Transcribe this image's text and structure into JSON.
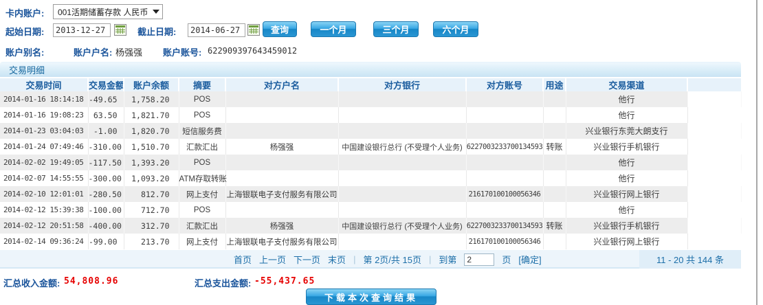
{
  "form": {
    "account_label": "卡内账户:",
    "account_select": "001活期储蓄存款 人民币",
    "start_label": "起始日期:",
    "start_value": "2013-12-27",
    "end_label": "截止日期:",
    "end_value": "2014-06-27",
    "query_button": "查询",
    "one_month_button": "一个月",
    "three_month_button": "三个月",
    "six_month_button": "六个月",
    "alias_label": "账户别名:",
    "alias_value": "",
    "holder_label": "账户户名:",
    "holder_value": "杨强强",
    "account_no_label": "账户账号:",
    "account_no_value": "622909397643459012"
  },
  "section_title": "交易明细",
  "table": {
    "headers": [
      "交易时间",
      "交易金额",
      "账户余额",
      "摘要",
      "对方户名",
      "对方银行",
      "对方账号",
      "用途",
      "交易渠道"
    ],
    "rows": [
      [
        "2014-01-16 18:14:18",
        "-49.65",
        "1,758.20",
        "POS",
        "",
        "",
        "",
        "",
        "他行"
      ],
      [
        "2014-01-16 19:08:23",
        "63.50",
        "1,821.70",
        "POS",
        "",
        "",
        "",
        "",
        "他行"
      ],
      [
        "2014-01-23 03:04:03",
        "-1.00",
        "1,820.70",
        "短信服务费",
        "",
        "",
        "",
        "",
        "兴业银行东莞大朗支行"
      ],
      [
        "2014-01-24 07:49:46",
        "-310.00",
        "1,510.70",
        "汇款汇出",
        "杨强强",
        "中国建设银行总行 (不受理个人业务)",
        "6227003233700134593",
        "转账",
        "兴业银行手机银行"
      ],
      [
        "2014-02-02 19:49:05",
        "-117.50",
        "1,393.20",
        "POS",
        "",
        "",
        "",
        "",
        "他行"
      ],
      [
        "2014-02-07 14:55:55",
        "-300.00",
        "1,093.20",
        "ATM存取转账",
        "",
        "",
        "",
        "",
        "他行"
      ],
      [
        "2014-02-10 12:01:01",
        "-280.50",
        "812.70",
        "网上支付",
        "上海银联电子支付服务有限公司",
        "",
        "216170100100056346",
        "",
        "兴业银行网上银行"
      ],
      [
        "2014-02-12 15:39:38",
        "-100.00",
        "712.70",
        "POS",
        "",
        "",
        "",
        "",
        "他行"
      ],
      [
        "2014-02-12 20:51:58",
        "-400.00",
        "312.70",
        "汇款汇出",
        "杨强强",
        "中国建设银行总行 (不受理个人业务)",
        "6227003233700134593",
        "转账",
        "兴业银行手机银行"
      ],
      [
        "2014-02-14 09:36:24",
        "-99.00",
        "213.70",
        "网上支付",
        "上海银联电子支付服务有限公司",
        "",
        "216170100100056346",
        "",
        "兴业银行网上银行"
      ]
    ]
  },
  "pagination": {
    "first": "首页",
    "prev": "上一页",
    "next": "下一页",
    "last": "末页",
    "page_info": "第 2页/共 15页",
    "goto_label": "到第",
    "goto_value": "2",
    "goto_suffix": "页",
    "confirm": "[确定]",
    "range_info": "11 - 20  共 144 条"
  },
  "summary": {
    "income_label": "汇总收入金额:",
    "income_value": "54,808.96",
    "expense_label": "汇总支出金额:",
    "expense_value": "-55,437.65",
    "download_button": "下载本次查询结果"
  },
  "colors": {
    "label_blue": "#1a549b",
    "link_blue": "#1c6ea8",
    "button_blue": "#2196d6",
    "negative_red": "#e60000",
    "row_alt_gray": "#ededed",
    "section_bar_blue": "#d9edf8"
  }
}
